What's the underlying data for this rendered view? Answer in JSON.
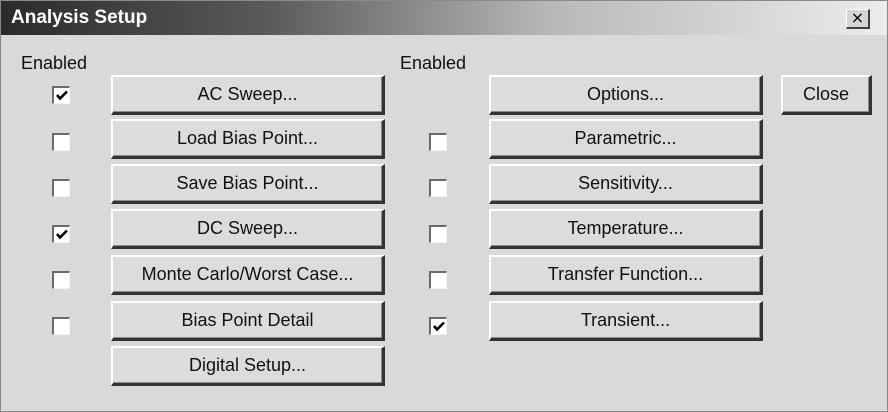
{
  "window": {
    "title": "Analysis Setup",
    "close_glyph": "×"
  },
  "left": {
    "enabled_header": "Enabled",
    "rows": [
      {
        "label": "AC Sweep...",
        "checked": true
      },
      {
        "label": "Load Bias Point...",
        "checked": false
      },
      {
        "label": "Save Bias Point...",
        "checked": false
      },
      {
        "label": "DC Sweep...",
        "checked": true
      },
      {
        "label": "Monte Carlo/Worst Case...",
        "checked": false
      },
      {
        "label": "Bias Point Detail",
        "checked": false
      },
      {
        "label": "Digital Setup...",
        "checked": null
      }
    ]
  },
  "right": {
    "enabled_header": "Enabled",
    "rows": [
      {
        "label": "Options...",
        "checked": null
      },
      {
        "label": "Parametric...",
        "checked": false
      },
      {
        "label": "Sensitivity...",
        "checked": false
      },
      {
        "label": "Temperature...",
        "checked": false
      },
      {
        "label": "Transfer Function...",
        "checked": false
      },
      {
        "label": "Transient...",
        "checked": true
      }
    ]
  },
  "close_button_label": "Close"
}
